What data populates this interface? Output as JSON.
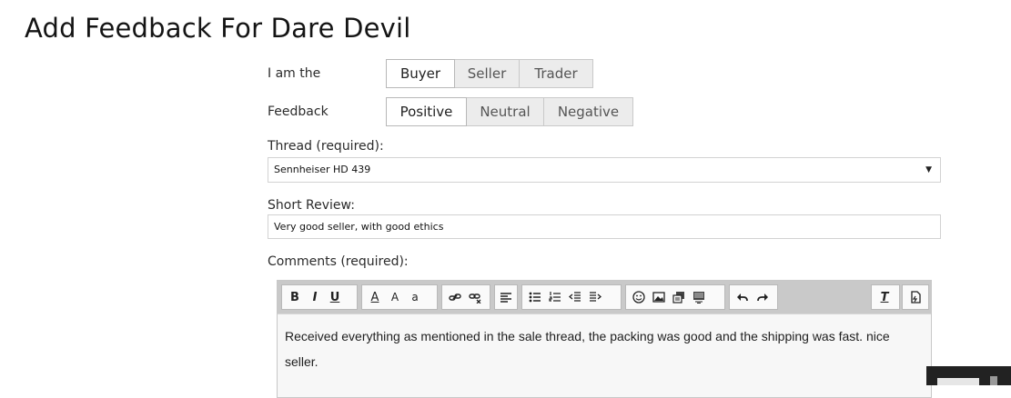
{
  "page": {
    "title": "Add Feedback For Dare Devil"
  },
  "role": {
    "label": "I am the",
    "options": [
      "Buyer",
      "Seller",
      "Trader"
    ],
    "selected": "Buyer"
  },
  "feedback": {
    "label": "Feedback",
    "options": [
      "Positive",
      "Neutral",
      "Negative"
    ],
    "selected": "Positive"
  },
  "thread": {
    "label": "Thread (required):",
    "value": "Sennheiser HD 439"
  },
  "short_review": {
    "label": "Short Review:",
    "value": "Very good seller, with good ethics"
  },
  "comments": {
    "label": "Comments (required):",
    "text": "Received everything as mentioned in the sale thread, the packing was good and the shipping was fast. nice seller."
  },
  "toolbar": {
    "bold": "B",
    "italic": "I",
    "underline": "U",
    "font_color": "A",
    "font_size": "A",
    "font_family": "a"
  },
  "icons": [
    "bold-icon",
    "italic-icon",
    "underline-icon",
    "font-color-icon",
    "font-size-icon",
    "font-family-icon",
    "link-icon",
    "unlink-icon",
    "align-icon",
    "bullet-list-icon",
    "numbered-list-icon",
    "outdent-icon",
    "indent-icon",
    "smiley-icon",
    "image-icon",
    "media-icon",
    "code-icon",
    "undo-icon",
    "redo-icon",
    "remove-format-icon",
    "toggle-source-icon"
  ],
  "colors": {
    "toolbar_bg": "#c9c9c9",
    "active_option": "#ffffff",
    "inactive_option": "#ececec"
  }
}
